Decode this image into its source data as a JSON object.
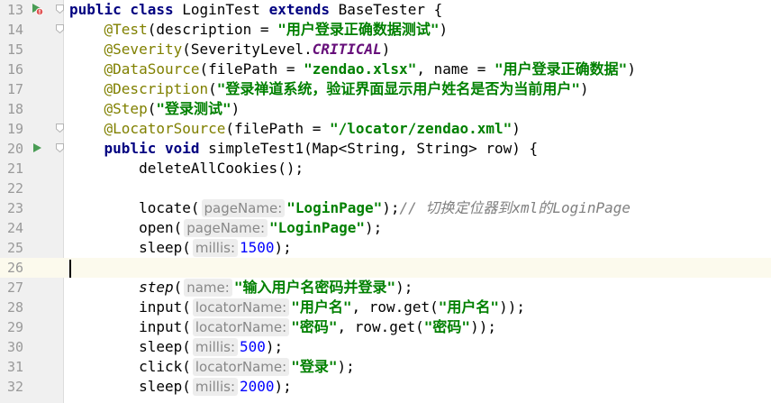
{
  "lines": [
    {
      "n": "13",
      "gutter": "run-test-class-icon",
      "fold": true,
      "segs": [
        [
          "kw",
          "public class "
        ],
        [
          "",
          "LoginTest "
        ],
        [
          "kw",
          "extends "
        ],
        [
          "",
          "BaseTester {"
        ]
      ]
    },
    {
      "n": "14",
      "gutter": "",
      "fold": true,
      "segs": [
        [
          "",
          "    "
        ],
        [
          "an",
          "@Test"
        ],
        [
          "",
          "(description = "
        ],
        [
          "str",
          "\"用户登录正确数据测试\""
        ],
        [
          "",
          ")"
        ]
      ]
    },
    {
      "n": "15",
      "gutter": "",
      "fold": false,
      "segs": [
        [
          "",
          "    "
        ],
        [
          "an",
          "@Severity"
        ],
        [
          "",
          "(SeverityLevel."
        ],
        [
          "en",
          "CRITICAL"
        ],
        [
          "",
          ")"
        ]
      ]
    },
    {
      "n": "16",
      "gutter": "",
      "fold": false,
      "segs": [
        [
          "",
          "    "
        ],
        [
          "an",
          "@DataSource"
        ],
        [
          "",
          "(filePath = "
        ],
        [
          "str",
          "\"zendao.xlsx\""
        ],
        [
          "",
          ", name = "
        ],
        [
          "str",
          "\"用户登录正确数据\""
        ],
        [
          "",
          ")"
        ]
      ]
    },
    {
      "n": "17",
      "gutter": "",
      "fold": false,
      "segs": [
        [
          "",
          "    "
        ],
        [
          "an",
          "@Description"
        ],
        [
          "",
          "("
        ],
        [
          "str",
          "\"登录禅道系统，验证界面显示用户姓名是否为当前用户\""
        ],
        [
          "",
          ")"
        ]
      ]
    },
    {
      "n": "18",
      "gutter": "",
      "fold": false,
      "segs": [
        [
          "",
          "    "
        ],
        [
          "an",
          "@Step"
        ],
        [
          "",
          "("
        ],
        [
          "str",
          "\"登录测试\""
        ],
        [
          "",
          ")"
        ]
      ]
    },
    {
      "n": "19",
      "gutter": "",
      "fold": true,
      "segs": [
        [
          "",
          "    "
        ],
        [
          "an",
          "@LocatorSource"
        ],
        [
          "",
          "(filePath = "
        ],
        [
          "str",
          "\"/locator/zendao.xml\""
        ],
        [
          "",
          ")"
        ]
      ]
    },
    {
      "n": "20",
      "gutter": "run-test-icon",
      "fold": true,
      "segs": [
        [
          "",
          "    "
        ],
        [
          "kw",
          "public void "
        ],
        [
          "",
          "simpleTest1(Map<String, String> row) {"
        ]
      ]
    },
    {
      "n": "21",
      "gutter": "",
      "fold": false,
      "segs": [
        [
          "",
          "        deleteAllCookies();"
        ]
      ]
    },
    {
      "n": "22",
      "gutter": "",
      "fold": false,
      "segs": []
    },
    {
      "n": "23",
      "gutter": "",
      "fold": false,
      "segs": [
        [
          "",
          "        locate("
        ],
        [
          "hint",
          "pageName:"
        ],
        [
          "str",
          "\"LoginPage\""
        ],
        [
          "",
          ");"
        ],
        [
          "cm",
          "// 切换定位器到xml的LoginPage"
        ]
      ]
    },
    {
      "n": "24",
      "gutter": "",
      "fold": false,
      "segs": [
        [
          "",
          "        open("
        ],
        [
          "hint",
          "pageName:"
        ],
        [
          "str",
          "\"LoginPage\""
        ],
        [
          "",
          ");"
        ]
      ]
    },
    {
      "n": "25",
      "gutter": "",
      "fold": false,
      "segs": [
        [
          "",
          "        sleep("
        ],
        [
          "hint",
          "millis:"
        ],
        [
          "num",
          "1500"
        ],
        [
          "",
          ");"
        ]
      ]
    },
    {
      "n": "26",
      "gutter": "",
      "fold": false,
      "current": true,
      "segs": []
    },
    {
      "n": "27",
      "gutter": "",
      "fold": false,
      "segs": [
        [
          "",
          "        "
        ],
        [
          "it",
          "step"
        ],
        [
          "",
          "("
        ],
        [
          "hint",
          "name:"
        ],
        [
          "str",
          "\"输入用户名密码并登录\""
        ],
        [
          "",
          ");"
        ]
      ]
    },
    {
      "n": "28",
      "gutter": "",
      "fold": false,
      "segs": [
        [
          "",
          "        input("
        ],
        [
          "hint",
          "locatorName:"
        ],
        [
          "str",
          "\"用户名\""
        ],
        [
          "",
          ", row.get("
        ],
        [
          "str",
          "\"用户名\""
        ],
        [
          "",
          "));"
        ]
      ]
    },
    {
      "n": "29",
      "gutter": "",
      "fold": false,
      "segs": [
        [
          "",
          "        input("
        ],
        [
          "hint",
          "locatorName:"
        ],
        [
          "str",
          "\"密码\""
        ],
        [
          "",
          ", row.get("
        ],
        [
          "str",
          "\"密码\""
        ],
        [
          "",
          "));"
        ]
      ]
    },
    {
      "n": "30",
      "gutter": "",
      "fold": false,
      "segs": [
        [
          "",
          "        sleep("
        ],
        [
          "hint",
          "millis:"
        ],
        [
          "num",
          "500"
        ],
        [
          "",
          ");"
        ]
      ]
    },
    {
      "n": "31",
      "gutter": "",
      "fold": false,
      "segs": [
        [
          "",
          "        click("
        ],
        [
          "hint",
          "locatorName:"
        ],
        [
          "str",
          "\"登录\""
        ],
        [
          "",
          ");"
        ]
      ]
    },
    {
      "n": "32",
      "gutter": "",
      "fold": false,
      "segs": [
        [
          "",
          "        sleep("
        ],
        [
          "hint",
          "millis:"
        ],
        [
          "num",
          "2000"
        ],
        [
          "",
          ");"
        ]
      ]
    }
  ],
  "colors": {
    "keyword": "#000080",
    "annotation": "#808000",
    "string": "#008000",
    "enum_constant": "#660e7a",
    "number": "#0000ff",
    "comment": "#808080",
    "line_number": "#999999",
    "run_icon": "#499c54",
    "error_badge": "#e05555"
  }
}
